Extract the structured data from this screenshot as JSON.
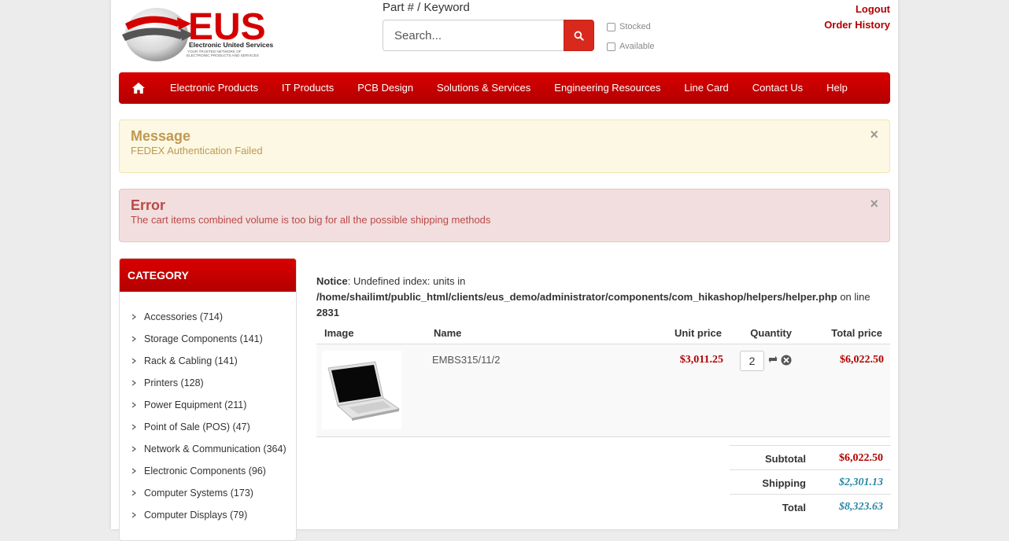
{
  "brand": {
    "logo_text": "EUS",
    "logo_subtitle": "Electronic United Services",
    "logo_tagline": "YOUR TRUSTED NETWORK OF ELECTRONIC PRODUCTS AND SERVICES",
    "accent_color": "#c40000"
  },
  "search": {
    "label": "Part # / Keyword",
    "placeholder": "Search...",
    "button_icon": "search-icon",
    "filters": [
      {
        "label": "Stocked",
        "checked": false
      },
      {
        "label": "Available",
        "checked": false
      }
    ]
  },
  "top_links": {
    "logout": "Logout",
    "order_history": "Order History"
  },
  "nav": {
    "home_icon": "home-icon",
    "items": [
      "Electronic Products",
      "IT Products",
      "PCB Design",
      "Solutions & Services",
      "Engineering Resources",
      "Line Card",
      "Contact Us",
      "Help"
    ]
  },
  "alerts": {
    "message": {
      "title": "Message",
      "text": "FEDEX Authentication Failed",
      "close": "×"
    },
    "error": {
      "title": "Error",
      "text": "The cart items combined volume is too big for all the possible shipping methods",
      "close": "×"
    }
  },
  "sidebar": {
    "title": "CATEGORY",
    "items": [
      "Accessories (714)",
      "Storage Components (141)",
      "Rack & Cabling (141)",
      "Printers (128)",
      "Power Equipment (211)",
      "Point of Sale (POS) (47)",
      "Network & Communication (364)",
      "Electronic Components (96)",
      "Computer Systems (173)",
      "Computer Displays (79)"
    ]
  },
  "notice": {
    "label": "Notice",
    "text": ": Undefined index: units in ",
    "path": "/home/shailimt/public_html/clients/eus_demo/administrator/components/com_hikashop/helpers/helper.php",
    "line_text": " on line ",
    "line": "2831"
  },
  "cart": {
    "columns": {
      "image": "Image",
      "name": "Name",
      "unit_price": "Unit price",
      "quantity": "Quantity",
      "total_price": "Total price"
    },
    "items": [
      {
        "name": "EMBS315/11/2",
        "unit_price": "$3,011.25",
        "quantity": "2",
        "total_price": "$6,022.50",
        "image_icon": "laptop-image"
      }
    ],
    "totals": {
      "subtotal_label": "Subtotal",
      "subtotal": "$6,022.50",
      "shipping_label": "Shipping",
      "shipping": "$2,301.13",
      "total_label": "Total",
      "total": "$8,323.63"
    }
  }
}
